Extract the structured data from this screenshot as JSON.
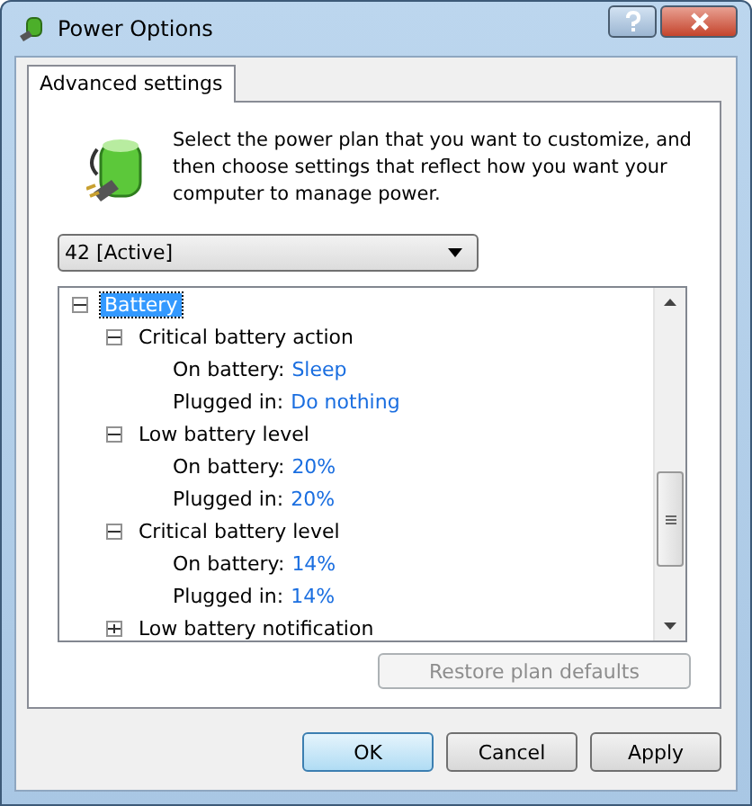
{
  "window": {
    "title": "Power Options"
  },
  "tabs": [
    {
      "label": "Advanced settings",
      "selected": true
    }
  ],
  "description": "Select the power plan that you want to customize, and then choose settings that reflect how you want your computer to manage power.",
  "plan_dropdown": {
    "value": "42 [Active]"
  },
  "tree": [
    {
      "label": "Battery",
      "selected": true,
      "expanded": true,
      "children": [
        {
          "label": "Critical battery action",
          "selected": false,
          "expanded": true,
          "children": [
            {
              "label": "On battery:",
              "value": "Sleep"
            },
            {
              "label": "Plugged in:",
              "value": "Do nothing"
            }
          ]
        },
        {
          "label": "Low battery level",
          "selected": false,
          "expanded": true,
          "children": [
            {
              "label": "On battery:",
              "value": "20%"
            },
            {
              "label": "Plugged in:",
              "value": "20%"
            }
          ]
        },
        {
          "label": "Critical battery level",
          "selected": false,
          "expanded": true,
          "children": [
            {
              "label": "On battery:",
              "value": "14%"
            },
            {
              "label": "Plugged in:",
              "value": "14%"
            }
          ]
        },
        {
          "label": "Low battery notification",
          "selected": false,
          "expanded": false
        }
      ]
    }
  ],
  "restore_button": {
    "label": "Restore plan defaults",
    "disabled": true
  },
  "buttons": [
    {
      "label": "OK",
      "default": true
    },
    {
      "label": "Cancel",
      "default": false
    },
    {
      "label": "Apply",
      "default": false
    }
  ]
}
